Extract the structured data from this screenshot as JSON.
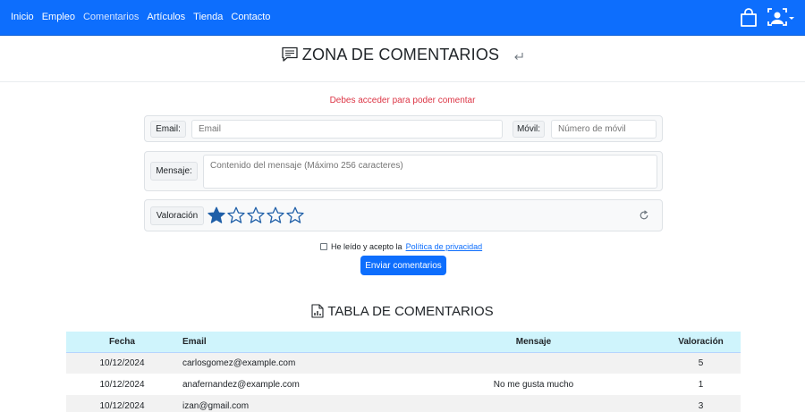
{
  "nav": {
    "items": [
      {
        "label": "Inicio"
      },
      {
        "label": "Empleo"
      },
      {
        "label": "Comentarios",
        "active": true
      },
      {
        "label": "Artículos"
      },
      {
        "label": "Tienda"
      },
      {
        "label": "Contacto"
      }
    ],
    "icons": [
      "shopping-bag-icon",
      "user-account-icon"
    ]
  },
  "comments_section": {
    "title": "ZONA DE COMENTARIOS",
    "title_icon": "chat-text-icon",
    "return_icon": "return-arrow-icon",
    "login_message": "Debes acceder para poder comentar"
  },
  "form": {
    "email_label": "Email:",
    "email_placeholder": "Email",
    "phone_label": "Móvil:",
    "phone_placeholder": "Número de móvil",
    "message_label": "Mensaje:",
    "message_placeholder": "Contenido del mensaje (Máximo 256 caracteres)",
    "rating_label": "Valoración",
    "rating_value": 1,
    "rating_max": 5,
    "consent_text": "He leído y acepto la",
    "privacy_link": "Política de privacidad",
    "submit_label": "Enviar comentarios"
  },
  "table_section": {
    "title": "TABLA DE COMENTARIOS",
    "title_icon": "table-chart-icon",
    "headers": {
      "fecha": "Fecha",
      "email": "Email",
      "mensaje": "Mensaje",
      "valoracion": "Valoración"
    },
    "rows": [
      {
        "fecha": "10/12/2024",
        "email": "carlosgomez@example.com",
        "mensaje": "",
        "valoracion": "5"
      },
      {
        "fecha": "10/12/2024",
        "email": "anafernandez@example.com",
        "mensaje": "No me gusta mucho",
        "valoracion": "1"
      },
      {
        "fecha": "10/12/2024",
        "email": "izan@gmail.com",
        "mensaje": "",
        "valoracion": "3"
      }
    ]
  },
  "colors": {
    "primary": "#0d6efd",
    "error": "#dc3545",
    "table_header": "#cff4fc",
    "star": "#1f5fa8"
  }
}
